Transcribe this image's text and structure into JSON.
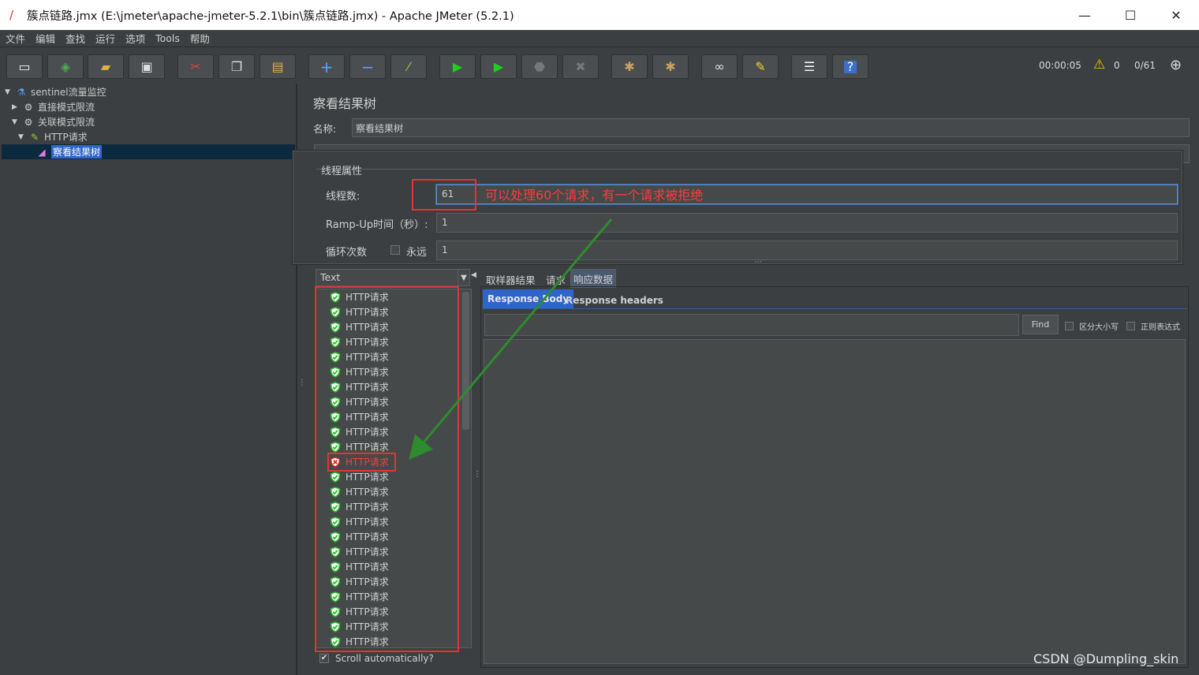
{
  "window": {
    "title": "簇点链路.jmx (E:\\jmeter\\apache-jmeter-5.2.1\\bin\\簇点链路.jmx) - Apache JMeter (5.2.1)",
    "minimize": "—",
    "maximize": "☐",
    "close": "✕"
  },
  "menu": [
    "文件",
    "编辑",
    "查找",
    "运行",
    "选项",
    "Tools",
    "帮助"
  ],
  "toolbar": {
    "buttons": [
      "new-icon",
      "templates-icon",
      "open-icon",
      "save-icon",
      "cut-icon",
      "copy-icon",
      "paste-icon",
      "expand-icon",
      "collapse-icon",
      "toggle-icon",
      "start-icon",
      "start-no-pause-icon",
      "stop-icon",
      "shutdown-icon",
      "clear-icon",
      "clear-all-icon",
      "search-icon",
      "reset-search-icon",
      "function-helper-icon",
      "help-icon"
    ],
    "elapsed": "00:00:05",
    "warnings": "0",
    "threads": "0/61"
  },
  "tree": {
    "items": [
      {
        "label": "sentinel流量监控",
        "arrow": "▼"
      },
      {
        "label": "直接模式限流",
        "arrow": "▶"
      },
      {
        "label": "关联模式限流",
        "arrow": "▼"
      },
      {
        "label": "HTTP请求",
        "arrow": "▼"
      },
      {
        "label": "察看结果树",
        "arrow": ""
      }
    ]
  },
  "panel": {
    "title": "察看结果树",
    "name_label": "名称:",
    "name_value": "察看结果树"
  },
  "overlay": {
    "group_title": "线程属性",
    "threads_label": "线程数:",
    "threads_value": "61",
    "rampup_label": "Ramp-Up时间（秒）:",
    "rampup_value": "1",
    "loop_label": "循环次数",
    "forever_label": "永远",
    "loop_value": "1",
    "annotation": "可以处理60个请求，有一个请求被拒绝"
  },
  "results": {
    "filter": "Text",
    "items": [
      {
        "label": "HTTP请求",
        "status": "success"
      },
      {
        "label": "HTTP请求",
        "status": "success"
      },
      {
        "label": "HTTP请求",
        "status": "success"
      },
      {
        "label": "HTTP请求",
        "status": "success"
      },
      {
        "label": "HTTP请求",
        "status": "success"
      },
      {
        "label": "HTTP请求",
        "status": "success"
      },
      {
        "label": "HTTP请求",
        "status": "success"
      },
      {
        "label": "HTTP请求",
        "status": "success"
      },
      {
        "label": "HTTP请求",
        "status": "success"
      },
      {
        "label": "HTTP请求",
        "status": "success"
      },
      {
        "label": "HTTP请求",
        "status": "success"
      },
      {
        "label": "HTTP请求",
        "status": "failure"
      },
      {
        "label": "HTTP请求",
        "status": "success"
      },
      {
        "label": "HTTP请求",
        "status": "success"
      },
      {
        "label": "HTTP请求",
        "status": "success"
      },
      {
        "label": "HTTP请求",
        "status": "success"
      },
      {
        "label": "HTTP请求",
        "status": "success"
      },
      {
        "label": "HTTP请求",
        "status": "success"
      },
      {
        "label": "HTTP请求",
        "status": "success"
      },
      {
        "label": "HTTP请求",
        "status": "success"
      },
      {
        "label": "HTTP请求",
        "status": "success"
      },
      {
        "label": "HTTP请求",
        "status": "success"
      },
      {
        "label": "HTTP请求",
        "status": "success"
      },
      {
        "label": "HTTP请求",
        "status": "success"
      }
    ],
    "scroll_auto": "Scroll automatically?"
  },
  "detail": {
    "tabs": [
      "取样器结果",
      "请求",
      "响应数据"
    ],
    "subtabs": [
      "Response Body",
      "Response headers"
    ],
    "find_button": "Find",
    "case_sensitive": "区分大小写",
    "regex": "正则表达式"
  },
  "watermark": "CSDN @Dumpling_skin",
  "colors": {
    "background": "#3c3f41",
    "selection": "#2f65ca",
    "annotation_red": "#e23434",
    "arrow_green": "#2e8b2e",
    "success_green": "#2eb82e",
    "failure_red": "#e02020"
  }
}
